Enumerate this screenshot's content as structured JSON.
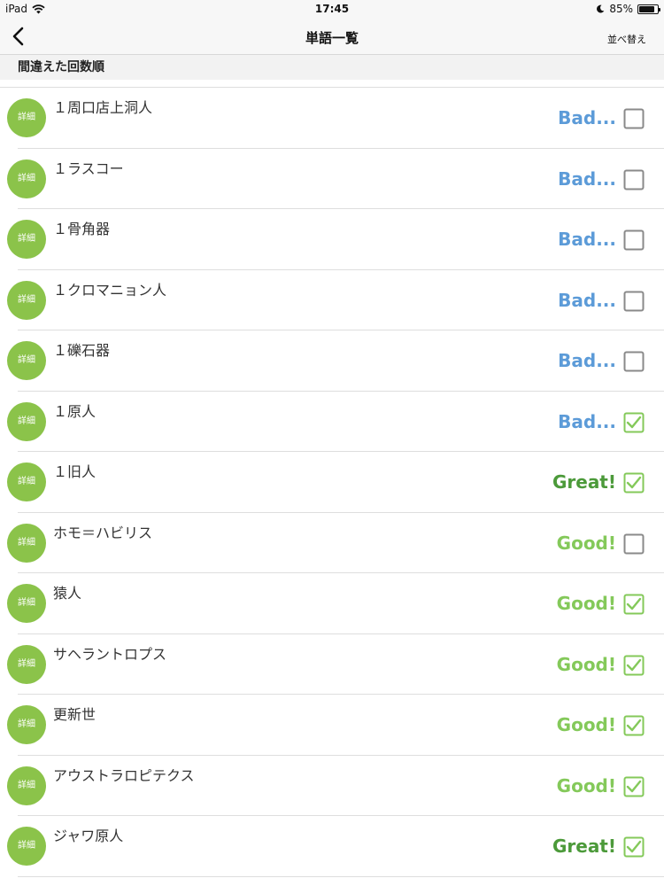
{
  "status": {
    "device": "iPad",
    "time": "17:45",
    "battery": "85%",
    "battery_level": 0.85
  },
  "nav": {
    "title": "単語一覧",
    "sort_label": "並べ替え"
  },
  "section": {
    "title": "間違えた回数順"
  },
  "detail_label": "詳細",
  "rows": [
    {
      "word": "１周口店上洞人",
      "rating": "Bad...",
      "rating_type": "bad",
      "checked": false
    },
    {
      "word": "１ラスコー",
      "rating": "Bad...",
      "rating_type": "bad",
      "checked": false
    },
    {
      "word": "１骨角器",
      "rating": "Bad...",
      "rating_type": "bad",
      "checked": false
    },
    {
      "word": "１クロマニョン人",
      "rating": "Bad...",
      "rating_type": "bad",
      "checked": false
    },
    {
      "word": "１礫石器",
      "rating": "Bad...",
      "rating_type": "bad",
      "checked": false
    },
    {
      "word": "１原人",
      "rating": "Bad...",
      "rating_type": "bad",
      "checked": true
    },
    {
      "word": "１旧人",
      "rating": "Great!",
      "rating_type": "great",
      "checked": true
    },
    {
      "word": "ホモ＝ハビリス",
      "rating": "Good!",
      "rating_type": "good",
      "checked": false
    },
    {
      "word": "猿人",
      "rating": "Good!",
      "rating_type": "good",
      "checked": true
    },
    {
      "word": "サヘラントロプス",
      "rating": "Good!",
      "rating_type": "good",
      "checked": true
    },
    {
      "word": "更新世",
      "rating": "Good!",
      "rating_type": "good",
      "checked": true
    },
    {
      "word": "アウストラロピテクス",
      "rating": "Good!",
      "rating_type": "good",
      "checked": true
    },
    {
      "word": "ジャワ原人",
      "rating": "Great!",
      "rating_type": "great",
      "checked": true
    }
  ],
  "colors": {
    "detail_button": "#8bc34a",
    "bad": "#5c9bd8",
    "great": "#4c9a3a",
    "good": "#84c95a",
    "checkbox_unchecked": "#8a8a8a",
    "checkbox_checked": "#84c95a"
  }
}
